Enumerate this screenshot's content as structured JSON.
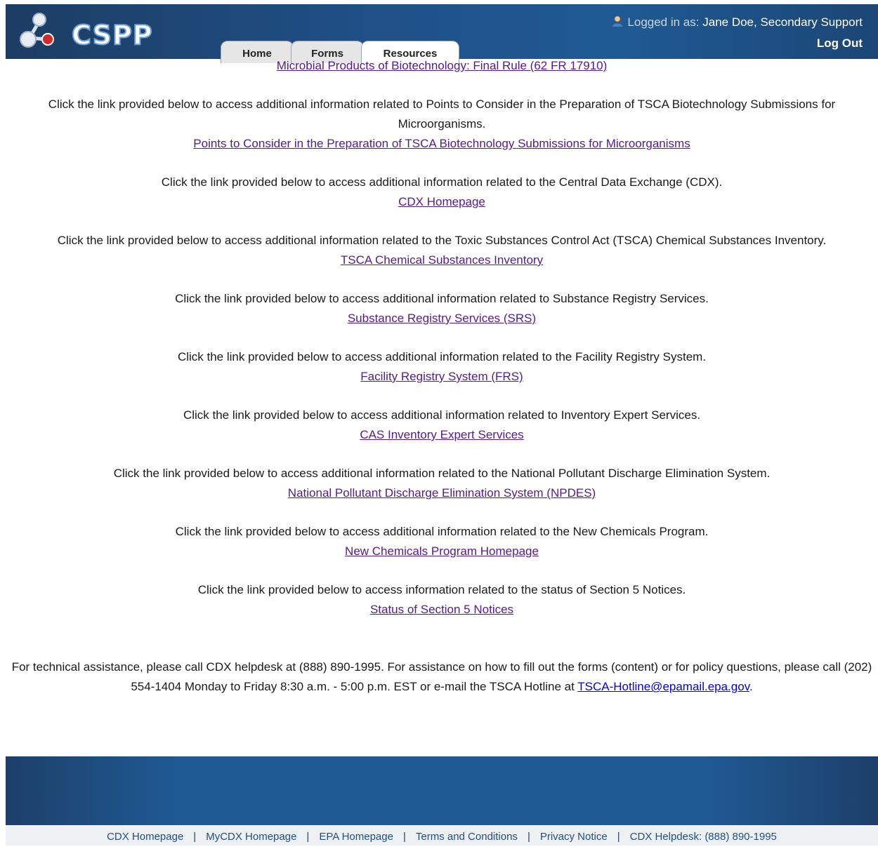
{
  "header": {
    "logo_text": "CSPP",
    "logged_in_label": "Logged in as:",
    "user_name": "Jane Doe, Secondary Support",
    "logout_label": "Log Out",
    "tabs": [
      {
        "label": "Home"
      },
      {
        "label": "Forms"
      },
      {
        "label": "Resources"
      }
    ]
  },
  "content": {
    "top_link": "Microbial Products of Biotechnology: Final Rule (62 FR 17910)",
    "blocks": [
      {
        "text": "Click the link provided below to access additional information related to Points to Consider in the Preparation of TSCA Biotechnology Submissions for Microorganisms.",
        "link": "Points to Consider in the Preparation of TSCA Biotechnology Submissions for Microorganisms"
      },
      {
        "text": "Click the link provided below to access additional information related to the Central Data Exchange (CDX).",
        "link": "CDX Homepage"
      },
      {
        "text": "Click the link provided below to access additional information related to the Toxic Substances Control Act (TSCA) Chemical Substances Inventory.",
        "link": "TSCA Chemical Substances Inventory"
      },
      {
        "text": "Click the link provided below to access additional information related to Substance Registry Services.",
        "link": "Substance Registry Services (SRS)"
      },
      {
        "text": "Click the link provided below to access additional information related to the Facility Registry System.",
        "link": "Facility Registry System (FRS)"
      },
      {
        "text": "Click the link provided below to access additional information related to Inventory Expert Services.",
        "link": "CAS Inventory Expert Services"
      },
      {
        "text": "Click the link provided below to access additional information related to the National Pollutant Discharge Elimination System.",
        "link": "National Pollutant Discharge Elimination System (NPDES)"
      },
      {
        "text": "Click the link provided below to access additional information related to the New Chemicals Program.",
        "link": "New Chemicals Program Homepage"
      },
      {
        "text": "Click the link provided below to access information related to the status of Section 5 Notices.",
        "link": "Status of Section 5 Notices"
      }
    ],
    "assistance_text": "For technical assistance, please call CDX helpdesk at (888) 890-1995. For assistance on how to fill out the forms (content) or for policy questions, please call (202) 554-1404 Monday to Friday 8:30 a.m. - 5:00 p.m. EST or e-mail the TSCA Hotline at",
    "hotline_email": "TSCA-Hotline@epamail.epa.gov",
    "assistance_end": "."
  },
  "footer": {
    "links": [
      "CDX Homepage",
      "MyCDX Homepage",
      "EPA Homepage",
      "Terms and Conditions",
      "Privacy Notice",
      "CDX Helpdesk: (888) 890-1995"
    ],
    "separator": "|"
  },
  "colors": {
    "header_blue": "#1f5a94",
    "visited_link": "#551a8b",
    "email_link": "#0000ee"
  }
}
